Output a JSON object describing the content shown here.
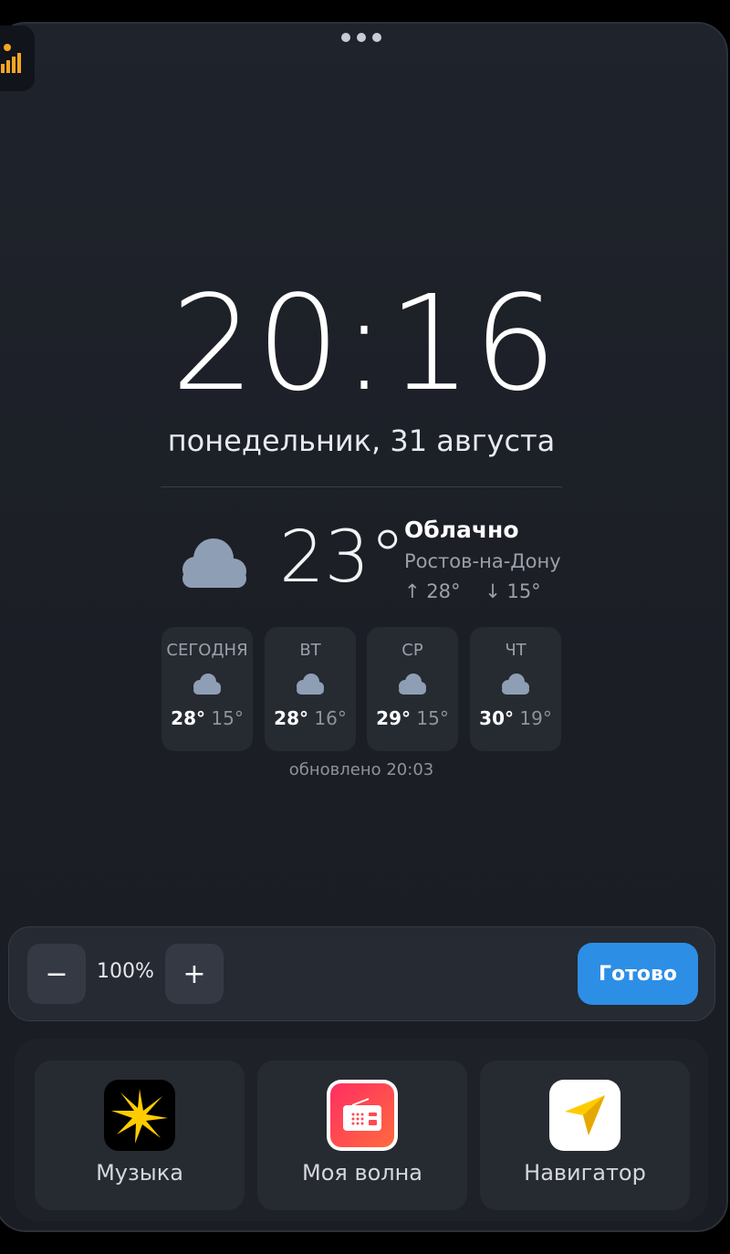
{
  "top": {
    "corner_app_icon": "weather-signal-app-icon",
    "menu_icon": "three-dots-icon"
  },
  "clock": {
    "time": "20:16",
    "date": "понедельник, 31 августа"
  },
  "weather": {
    "icon": "cloud-icon",
    "temperature": "23°",
    "condition": "Облачно",
    "city": "Ростов-на-Дону",
    "high": "↑ 28°",
    "low": "↓ 15°",
    "forecast": [
      {
        "day": "СЕГОДНЯ",
        "hi": "28°",
        "lo": "15°",
        "icon": "cloud-icon"
      },
      {
        "day": "ВТ",
        "hi": "28°",
        "lo": "16°",
        "icon": "cloud-icon"
      },
      {
        "day": "СР",
        "hi": "29°",
        "lo": "15°",
        "icon": "cloud-icon"
      },
      {
        "day": "ЧТ",
        "hi": "30°",
        "lo": "19°",
        "icon": "cloud-icon"
      }
    ],
    "updated": "обновлено 20:03"
  },
  "zoom": {
    "minus": "−",
    "value": "100%",
    "plus": "+",
    "done": "Готово"
  },
  "dock": {
    "apps": [
      {
        "label": "Музыка",
        "icon": "yandex-music-icon",
        "color": "#000000"
      },
      {
        "label": "Моя волна",
        "icon": "radio-icon",
        "color": "#f2435b"
      },
      {
        "label": "Навигатор",
        "icon": "navigator-arrow-icon",
        "color": "#ffffff"
      }
    ]
  },
  "colors": {
    "accent": "#2d8ee6",
    "cloud": "#8e9fb5",
    "background": "#1d2027"
  }
}
